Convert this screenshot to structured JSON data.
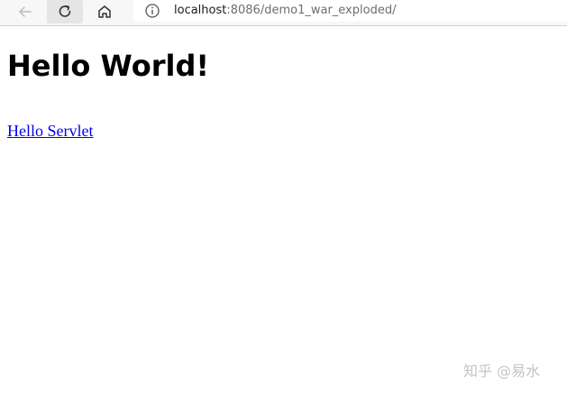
{
  "browser": {
    "url_host": "localhost",
    "url_path": ":8086/demo1_war_exploded/",
    "icons": {
      "back": "arrow-left-icon",
      "reload": "reload-icon",
      "home": "home-icon",
      "site_info": "info-icon"
    }
  },
  "page": {
    "heading": "Hello World!",
    "link_text": "Hello Servlet"
  },
  "watermark": "知乎 @易水",
  "colors": {
    "link": "#0000ee",
    "heading": "#000000",
    "toolbar_bg": "#f7f7f7"
  }
}
